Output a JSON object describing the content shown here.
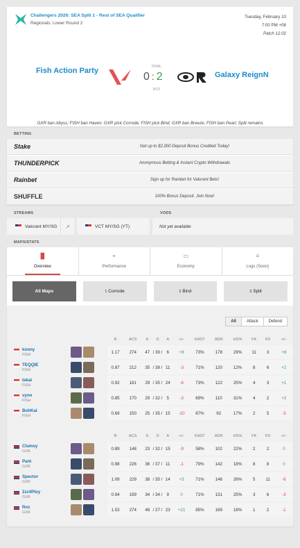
{
  "match": {
    "event_title": "Challengers 2026: SEA Split 1 - Rest of SEA Qualifier",
    "event_stage": "Regionals: Lower Round 2",
    "date": "Tuesday, February 10",
    "time": "7:00 PM +08",
    "patch": "Patch 12.02",
    "team1": "Fish Action Party",
    "team2": "Galaxy ReignN",
    "status": "FINAL",
    "score1": "0",
    "score2": "2",
    "colon": ":",
    "format": "BO3",
    "veto": "GXR ban Abyss; FISH ban Haven; GXR pick Corrode; FISH pick Bind; GXR ban Breeze; FISH ban Pearl; Split remains"
  },
  "betting": {
    "header": "BETTING",
    "rows": [
      {
        "logo": "Stake",
        "text": "Get up to $2,000 Deposit Bonus Credited Today!"
      },
      {
        "logo": "THUNDERPICK",
        "text": "Anonymous Betting & Instant Crypto Withdrawals"
      },
      {
        "logo": "Rainbet",
        "text": "Sign up for Rainbet for Valorant Bets!"
      },
      {
        "logo": "SHUFFLE",
        "text": "100% Bonus Deposit. Join Now!"
      }
    ]
  },
  "streams": {
    "header": "STREAMS",
    "items": [
      "Valorant MY/SG",
      "VCT MY/SG (YT)"
    ]
  },
  "vods": {
    "header": "VODS",
    "text": "Not yet available"
  },
  "stats_header": "MAPS/STATS",
  "tabs": [
    {
      "label": "Overview",
      "icon": "bar-chart-icon"
    },
    {
      "label": "Performance",
      "icon": "crosshair-icon"
    },
    {
      "label": "Economy",
      "icon": "money-icon"
    },
    {
      "label": "Logs (Soon)",
      "icon": "list-icon"
    }
  ],
  "maps": [
    {
      "num": "",
      "label": "All Maps"
    },
    {
      "num": "1",
      "label": "Corrode"
    },
    {
      "num": "2",
      "label": "Bind"
    },
    {
      "num": "3",
      "label": "Split"
    }
  ],
  "filters": [
    "All",
    "Attack",
    "Defend"
  ],
  "columns": [
    "R",
    "ACS",
    "K",
    "D",
    "A",
    "+/–",
    "KAST",
    "ADR",
    "HS%",
    "FK",
    "FD",
    "+/–"
  ],
  "team1_players": [
    {
      "name": "koony",
      "team": "FISH",
      "r": "1.17",
      "acs": "274",
      "k": "47",
      "d": "39",
      "a": "6",
      "pm": "+8",
      "kast": "73%",
      "adr": "178",
      "hs": "29%",
      "fk": "11",
      "fd": "3",
      "fpm": "+8"
    },
    {
      "name": "TEQQIE",
      "team": "FISH",
      "r": "0.87",
      "acs": "212",
      "k": "35",
      "d": "38",
      "a": "11",
      "pm": "-3",
      "kast": "71%",
      "adr": "120",
      "hs": "12%",
      "fk": "8",
      "fd": "6",
      "fpm": "+2"
    },
    {
      "name": "takai",
      "team": "FISH",
      "r": "0.92",
      "acs": "181",
      "k": "29",
      "d": "35",
      "a": "24",
      "pm": "-6",
      "kast": "73%",
      "adr": "122",
      "hs": "25%",
      "fk": "4",
      "fd": "3",
      "fpm": "+1"
    },
    {
      "name": "vynn",
      "team": "FISH",
      "r": "0.85",
      "acs": "170",
      "k": "29",
      "d": "32",
      "a": "5",
      "pm": "-3",
      "kast": "69%",
      "adr": "110",
      "hs": "31%",
      "fk": "4",
      "fd": "2",
      "fpm": "+2"
    },
    {
      "name": "BohKai",
      "team": "FISH",
      "r": "0.69",
      "acs": "150",
      "k": "25",
      "d": "35",
      "a": "15",
      "pm": "-10",
      "kast": "67%",
      "adr": "92",
      "hs": "17%",
      "fk": "2",
      "fd": "5",
      "fpm": "-3"
    }
  ],
  "team2_players": [
    {
      "name": "Clumsy",
      "team": "GXR",
      "r": "0.89",
      "acs": "148",
      "k": "23",
      "d": "32",
      "a": "15",
      "pm": "-9",
      "kast": "58%",
      "adr": "102",
      "hs": "22%",
      "fk": "2",
      "fd": "2",
      "fpm": "0"
    },
    {
      "name": "Park",
      "team": "GXR",
      "r": "0.98",
      "acs": "226",
      "k": "36",
      "d": "37",
      "a": "11",
      "pm": "-1",
      "kast": "79%",
      "adr": "142",
      "hs": "18%",
      "fk": "8",
      "fd": "8",
      "fpm": "0"
    },
    {
      "name": "Spector",
      "team": "GXR",
      "r": "1.09",
      "acs": "229",
      "k": "38",
      "d": "35",
      "a": "14",
      "pm": "+3",
      "kast": "71%",
      "adr": "146",
      "hs": "26%",
      "fk": "5",
      "fd": "11",
      "fpm": "-6"
    },
    {
      "name": "2zz4Ploy",
      "team": "GXR",
      "r": "0.94",
      "acs": "199",
      "k": "34",
      "d": "34",
      "a": "9",
      "pm": "0",
      "kast": "71%",
      "adr": "131",
      "hs": "25%",
      "fk": "3",
      "fd": "6",
      "fpm": "-3"
    },
    {
      "name": "Roz",
      "team": "GXR",
      "r": "1.53",
      "acs": "274",
      "k": "48",
      "d": "27",
      "a": "23",
      "pm": "+21",
      "kast": "85%",
      "adr": "169",
      "hs": "18%",
      "fk": "1",
      "fd": "2",
      "fpm": "-1"
    }
  ],
  "colors": {
    "accent": "#1f8cc8",
    "win": "#3e9b4f",
    "loss": "#d04a4a"
  }
}
